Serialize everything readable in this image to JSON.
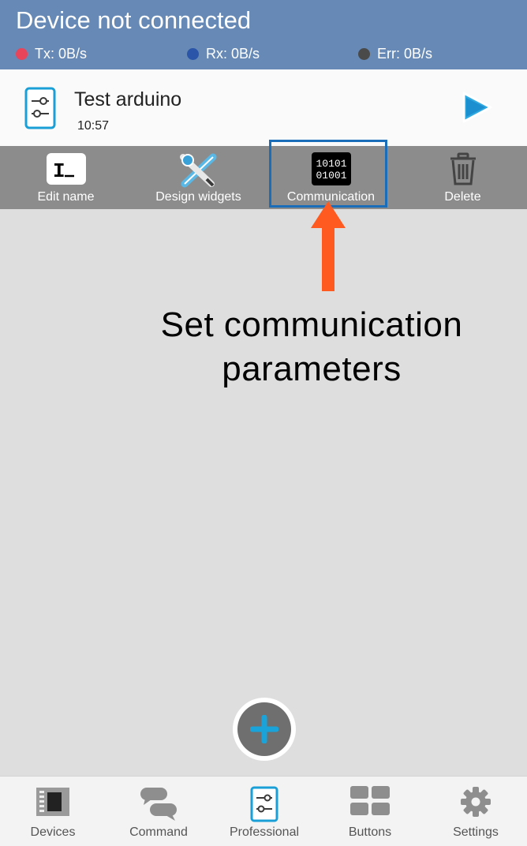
{
  "header": {
    "title": "Device not connected",
    "stats": [
      {
        "label": "Tx: 0B/s",
        "color": "#e8445a"
      },
      {
        "label": "Rx: 0B/s",
        "color": "#2a55a8"
      },
      {
        "label": "Err: 0B/s",
        "color": "#4a4a4a"
      }
    ]
  },
  "device": {
    "name": "Test arduino",
    "time": "10:57",
    "icon": "sliders-icon",
    "run_icon": "play-icon"
  },
  "actions": [
    {
      "label": "Edit name",
      "icon": "text-cursor-icon"
    },
    {
      "label": "Design widgets",
      "icon": "design-tools-icon"
    },
    {
      "label": "Communication",
      "icon": "binary-icon",
      "icon_text": [
        "10101",
        "01001"
      ]
    },
    {
      "label": "Delete",
      "icon": "trash-icon"
    }
  ],
  "annotation": {
    "text_line1": "Set communication",
    "text_line2": "parameters",
    "arrow_color": "#ff5a1f",
    "highlight_color": "#1a6db8"
  },
  "fab": {
    "icon": "plus-icon",
    "color": "#1aa3d9"
  },
  "bottom_nav": [
    {
      "label": "Devices",
      "icon": "device-board-icon"
    },
    {
      "label": "Command",
      "icon": "chat-bubbles-icon"
    },
    {
      "label": "Professional",
      "icon": "sliders-icon",
      "active": true
    },
    {
      "label": "Buttons",
      "icon": "grid-buttons-icon"
    },
    {
      "label": "Settings",
      "icon": "gear-icon"
    }
  ]
}
